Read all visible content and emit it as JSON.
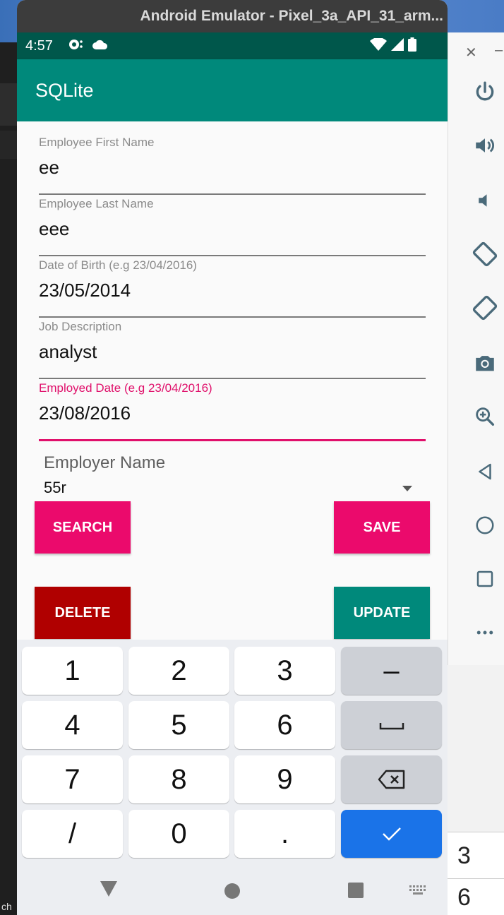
{
  "window": {
    "title": "Android Emulator - Pixel_3a_API_31_arm..."
  },
  "statusbar": {
    "time": "4:57"
  },
  "appbar": {
    "title": "SQLite"
  },
  "form": {
    "first_name": {
      "label": "Employee First Name",
      "value": "ee"
    },
    "last_name": {
      "label": "Employee Last Name",
      "value": "eee"
    },
    "dob": {
      "label": "Date of Birth (e.g 23/04/2016)",
      "value": "23/05/2014"
    },
    "job": {
      "label": "Job Description",
      "value": "analyst"
    },
    "employed": {
      "label": "Employed Date (e.g 23/04/2016)",
      "value": "23/08/2016"
    },
    "employer": {
      "label": "Employer Name",
      "selected": "55r"
    }
  },
  "buttons": {
    "search": "SEARCH",
    "save": "SAVE",
    "delete": "DELETE",
    "update": "UPDATE"
  },
  "keyboard": {
    "keys": [
      "1",
      "2",
      "3",
      "–",
      "4",
      "5",
      "6",
      "7",
      "8",
      "9",
      "/",
      "0",
      "."
    ]
  },
  "background": {
    "peek_1": "3",
    "peek_2": "6",
    "left_text": "ch"
  },
  "colors": {
    "primary": "#00897b",
    "primary_dark": "#00574b",
    "accent": "#eb0a6c",
    "delete": "#b00000",
    "keyboard_enter": "#1a73e8"
  },
  "icons": {
    "panel": [
      "power-icon",
      "volume-up-icon",
      "volume-down-icon",
      "rotate-left-icon",
      "rotate-right-icon",
      "camera-icon",
      "zoom-icon",
      "back-icon",
      "home-icon",
      "overview-icon",
      "more-icon"
    ]
  }
}
